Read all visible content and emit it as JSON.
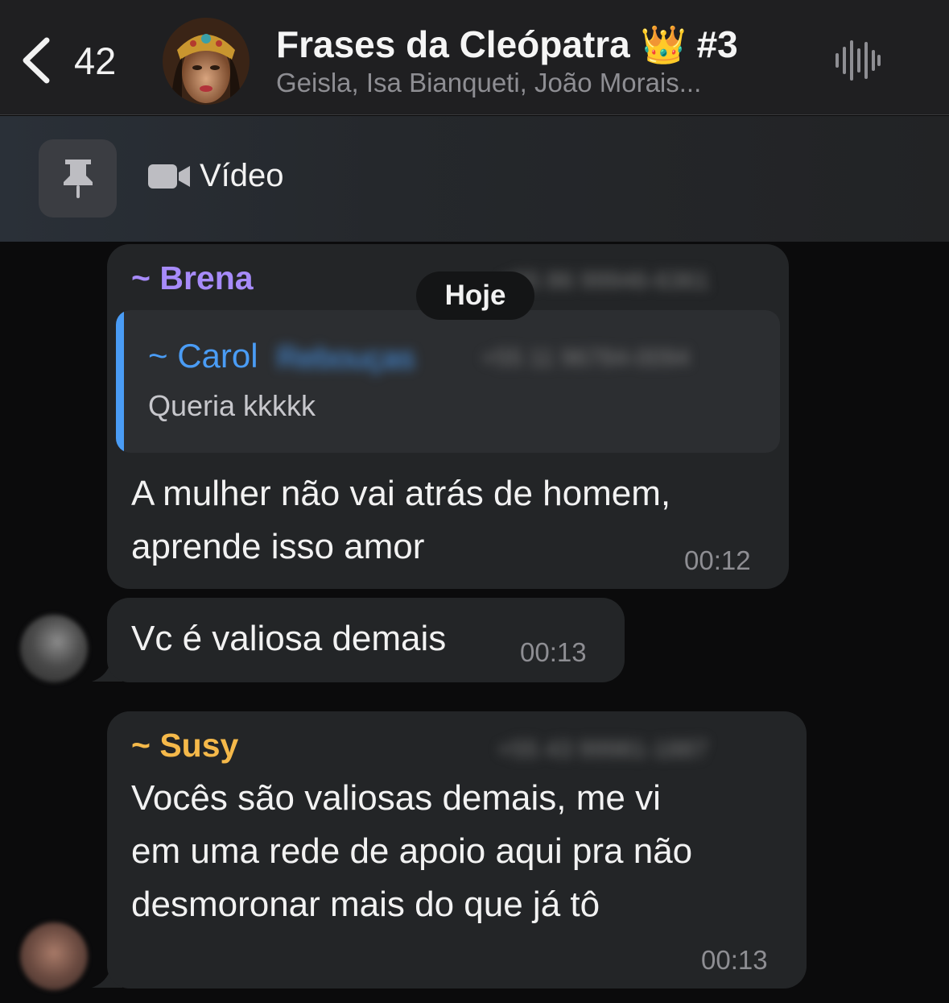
{
  "header": {
    "back_count": "42",
    "title": "Frases da Cleópatra 👑 #3",
    "members": "Geisla, Isa Bianqueti, João Morais..."
  },
  "pinned": {
    "label": "Vídeo"
  },
  "date_chip": "Hoje",
  "messages": [
    {
      "sender": "~ Brena",
      "sender_color": "#a78bfa",
      "phone": "+55 86 99946-6361",
      "reply": {
        "sender": "~ Carol",
        "sender_extra": "Rebouças",
        "phone": "+55 11 96784-0094",
        "text": "Queria kkkkk"
      },
      "lines": [
        "A mulher não vai atrás de homem,",
        "aprende isso amor"
      ],
      "time": "00:12"
    },
    {
      "lines": [
        "Vc é valiosa demais"
      ],
      "time": "00:13"
    },
    {
      "sender": "~ Susy",
      "sender_color": "#f5b94a",
      "phone": "+55 43 99981-1887",
      "lines": [
        "Vocês são valiosas demais, me vi",
        "em uma rede de apoio aqui pra não",
        "desmoronar mais do que já tô"
      ],
      "time": "00:13"
    }
  ],
  "colors": {
    "reply_sender": "#4a9cf5",
    "accent_blue": "#4a9cf5"
  },
  "icons": {
    "back": "chevron-left-icon",
    "waveform": "waveform-icon",
    "pin": "pin-icon",
    "video": "video-camera-icon"
  }
}
